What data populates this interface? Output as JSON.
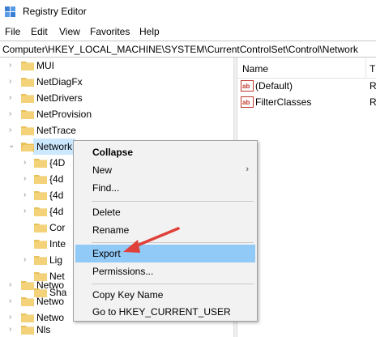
{
  "window": {
    "title": "Registry Editor"
  },
  "menu": [
    "File",
    "Edit",
    "View",
    "Favorites",
    "Help"
  ],
  "address": "Computer\\HKEY_LOCAL_MACHINE\\SYSTEM\\CurrentControlSet\\Control\\Network",
  "tree": {
    "items": [
      "MUI",
      "NetDiagFx",
      "NetDrivers",
      "NetProvision",
      "NetTrace",
      "Network"
    ],
    "children": [
      "{4D",
      "{4d",
      "{4d",
      "{4d",
      "Cor",
      "Inte",
      "Lig",
      "Net",
      "Sha"
    ],
    "after": [
      "Netwo",
      "Netwo",
      "Netwo",
      "Nls"
    ]
  },
  "values": {
    "columns": {
      "name": "Name",
      "type": "T"
    },
    "rows": [
      {
        "name": "(Default)",
        "type": "R"
      },
      {
        "name": "FilterClasses",
        "type": "R"
      }
    ]
  },
  "context_menu": {
    "collapse": "Collapse",
    "new": "New",
    "find": "Find...",
    "delete": "Delete",
    "rename": "Rename",
    "export": "Export",
    "permissions": "Permissions...",
    "copy_key": "Copy Key Name",
    "goto": "Go to HKEY_CURRENT_USER"
  },
  "colors": {
    "selection": "#cce8ff",
    "menu_hover": "#91c9f7",
    "folder": "#e8c15a",
    "annotation_arrow": "#e0403a"
  }
}
